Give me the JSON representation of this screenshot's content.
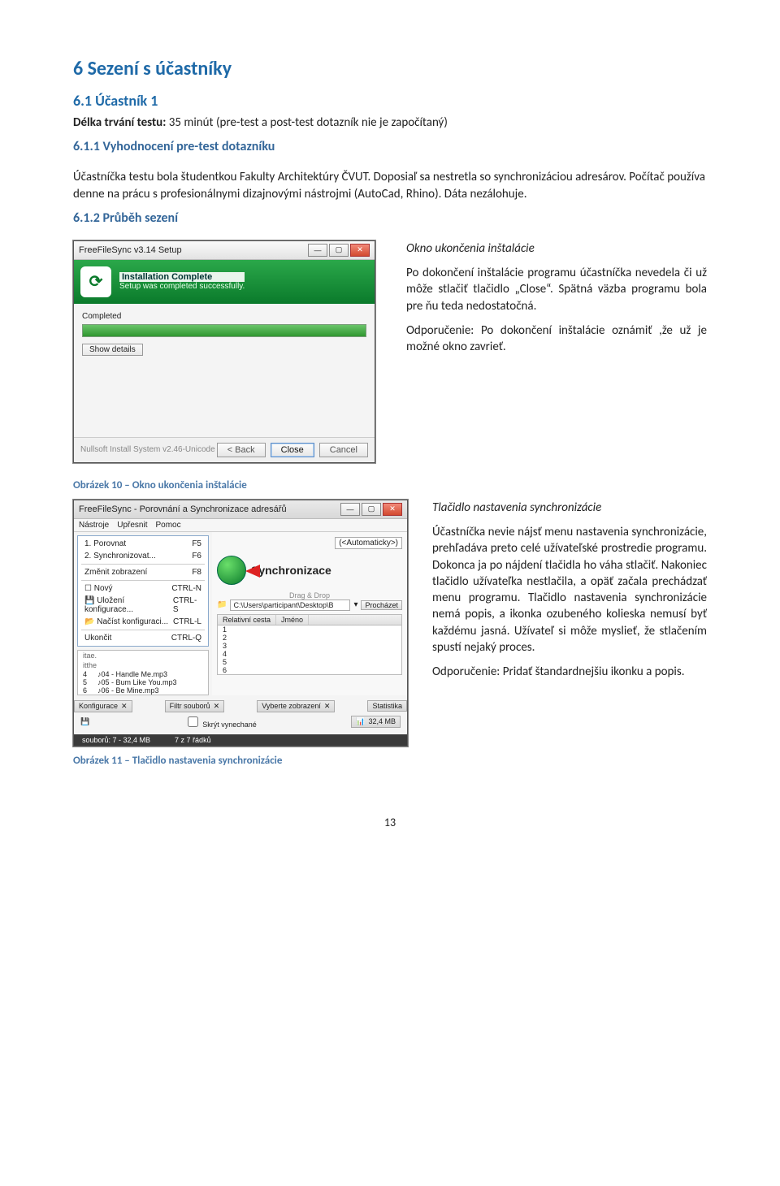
{
  "heading_1": "6   Sezení s účastníky",
  "heading_2": "6.1   Účastník 1",
  "delka_label": "Délka trvání testu:",
  "delka_value": "35 minút (pre-test a post-test  dotazník nie je započítaný)",
  "heading_3_1": "6.1.1    Vyhodnocení pre-test dotazníku",
  "para_pretest": "Účastníčka testu bola študentkou Fakulty Architektúry ČVUT. Doposiaľ sa nestretla so synchronizáciou adresárov. Počítač používa denne na prácu s profesionálnymi dizajnovými nástrojmi (AutoCad, Rhino). Dáta nezálohuje.",
  "heading_3_2": "6.1.2    Průběh sezení",
  "installer": {
    "title": "FreeFileSync v3.14 Setup",
    "header_title": "Installation Complete",
    "header_sub": "Setup was completed successfully.",
    "progress_label": "Completed",
    "show_details": "Show details",
    "ns_text": "Nullsoft Install System v2.46-Unicode",
    "btn_back": "< Back",
    "btn_close": "Close",
    "btn_cancel": "Cancel"
  },
  "desc1": {
    "title": "Okno ukončenia inštalácie",
    "p1": "Po dokončení inštalácie programu účastníčka nevedela či už môže stlačiť tlačidlo „Close“. Spätná väzba programu bola pre ňu teda nedostatočná.",
    "p2": "Odporučenie: Po dokončení inštalácie oznámiť ,že už je možné okno zavrieť."
  },
  "caption1": "Obrázek 10 – Okno ukončenia inštalácie",
  "sync": {
    "title": "FreeFileSync - Porovnání a Synchronizace adresářů",
    "menubar": [
      "Nástroje",
      "Upřesnit",
      "Pomoc"
    ],
    "menu_items": [
      {
        "label": "1. Porovnat",
        "shortcut": "F5"
      },
      {
        "label": "2. Synchronizovat...",
        "shortcut": "F6"
      },
      {
        "label": "Změnit zobrazení",
        "shortcut": "F8"
      },
      {
        "label": "Nový",
        "shortcut": "CTRL-N"
      },
      {
        "label": "Uložení konfigurace...",
        "shortcut": "CTRL-S"
      },
      {
        "label": "Načíst konfiguraci...",
        "shortcut": "CTRL-L"
      },
      {
        "label": "Ukončit",
        "shortcut": "CTRL-Q"
      }
    ],
    "auto_label": "(<Automaticky>)",
    "sync_label": "Synchronizace",
    "drag_label": "Drag & Drop",
    "path": "C:\\Users\\participant\\Desktop\\B",
    "browse": "Procházet",
    "col_headers": [
      "Relativní cesta",
      "Jméno"
    ],
    "left_rows": [
      "04 - Handle Me.mp3",
      "05 - Bum Like You.mp3",
      "06 - Be Mine.mp3"
    ],
    "left_extra": [
      "itae.",
      "itthe"
    ],
    "left_nums": [
      "4",
      "5",
      "6"
    ],
    "right_nums_top": [
      "1",
      "2",
      "3"
    ],
    "right_nums_bot": [
      "4",
      "5",
      "6"
    ],
    "tabs": [
      "Konfigurace",
      "Filtr souborů",
      "Vyberte zobrazení",
      "Statistika"
    ],
    "skryt": "Skrýt vynechané",
    "size_badge": "32,4 MB",
    "status_left": "souborů: 7 - 32,4 MB",
    "status_right": "7 z 7 řádků"
  },
  "caption2": "Obrázek 11 – Tlačidlo nastavenia synchronizácie",
  "desc2": {
    "title": "Tlačidlo nastavenia synchronizácie",
    "p1": "Účastníčka nevie nájsť menu nastavenia synchronizácie, prehľadáva preto celé užívateľské prostredie programu. Dokonca ja po nájdení tlačidla ho váha stlačiť. Nakoniec tlačidlo užívateľka nestlačila, a opäť začala prechádzať menu programu. Tlačidlo nastavenia synchronizácie nemá popis, a ikonka ozubeného kolieska nemusí byť každému jasná. Užívateľ si môže myslieť, že stlačením spustí nejaký proces.",
    "p2": "Odporučenie: Pridať štandardnejšiu ikonku a popis."
  },
  "page_number": "13"
}
